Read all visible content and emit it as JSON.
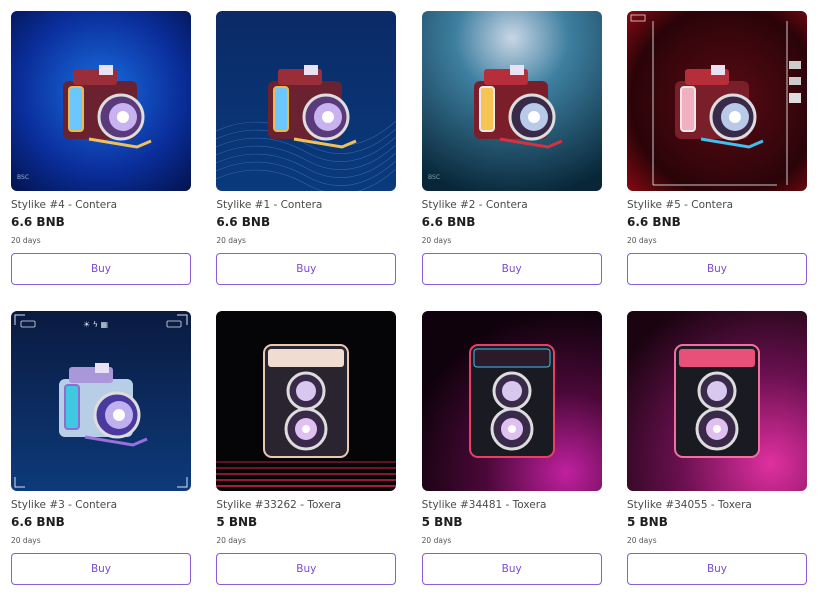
{
  "items": [
    {
      "title": "Stylike #4 - Contera",
      "price": "6.6 BNB",
      "days": "20 days",
      "buy": "Buy",
      "tag": "BSC",
      "style": "contera",
      "bg": "blue-grad"
    },
    {
      "title": "Stylike #1 - Contera",
      "price": "6.6 BNB",
      "days": "20 days",
      "buy": "Buy",
      "tag": "",
      "style": "contera",
      "bg": "wave"
    },
    {
      "title": "Stylike #2 - Contera",
      "price": "6.6 BNB",
      "days": "20 days",
      "buy": "Buy",
      "tag": "BSC",
      "style": "contera",
      "bg": "teal"
    },
    {
      "title": "Stylike #5 - Contera",
      "price": "6.6 BNB",
      "days": "20 days",
      "buy": "Buy",
      "tag": "",
      "style": "contera",
      "bg": "red-hud"
    },
    {
      "title": "Stylike #3 - Contera",
      "price": "6.6 BNB",
      "days": "20 days",
      "buy": "Buy",
      "tag": "",
      "style": "contera",
      "bg": "blue-hud"
    },
    {
      "title": "Stylike #33262 - Toxera",
      "price": "5 BNB",
      "days": "20 days",
      "buy": "Buy",
      "tag": "",
      "style": "toxera",
      "bg": "black-dots"
    },
    {
      "title": "Stylike #34481 - Toxera",
      "price": "5 BNB",
      "days": "20 days",
      "buy": "Buy",
      "tag": "",
      "style": "toxera",
      "bg": "purple"
    },
    {
      "title": "Stylike #34055 - Toxera",
      "price": "5 BNB",
      "days": "20 days",
      "buy": "Buy",
      "tag": "",
      "style": "toxera",
      "bg": "magenta"
    }
  ],
  "colors": {
    "accent": "#7b4bcf",
    "border": "#8a5cd6"
  }
}
